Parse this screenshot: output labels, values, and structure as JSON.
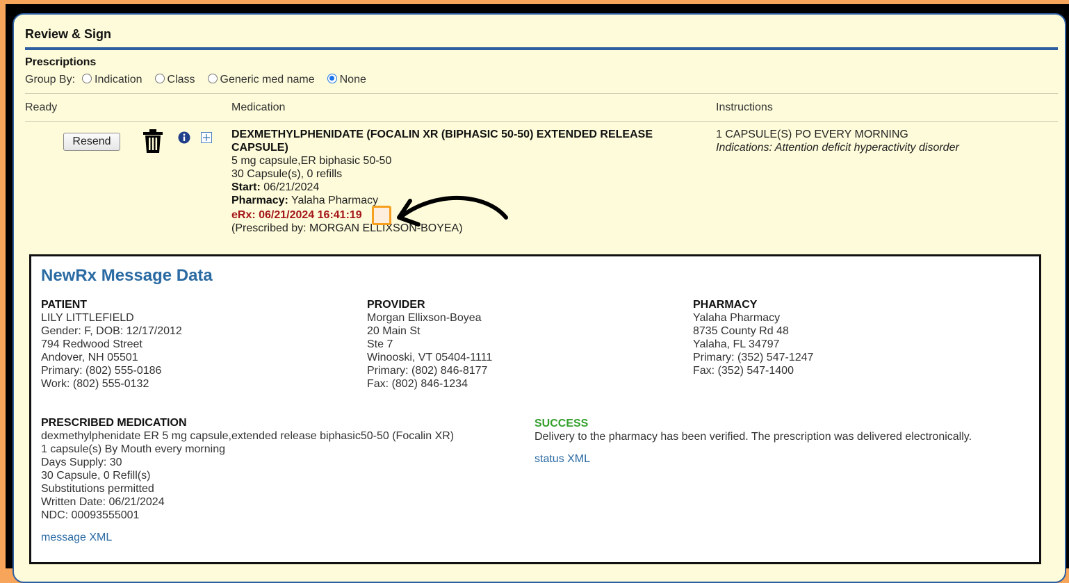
{
  "panel": {
    "title": "Review & Sign",
    "section_heading": "Prescriptions",
    "group_by": {
      "label": "Group By:",
      "options": [
        "Indication",
        "Class",
        "Generic med name",
        "None"
      ],
      "selected": "None"
    }
  },
  "table": {
    "headers": {
      "ready": "Ready",
      "medication": "Medication",
      "instructions": "Instructions"
    },
    "row": {
      "resend_label": "Resend",
      "icons": [
        "trash-icon",
        "info-icon",
        "expand-icon"
      ],
      "medication": {
        "name": "DEXMETHYLPHENIDATE (FOCALIN XR (BIPHASIC 50-50) EXTENDED RELEASE CAPSULE)",
        "form": "5 mg capsule,ER biphasic 50-50",
        "quantity": "30 Capsule(s), 0 refills",
        "start_label": "Start:",
        "start_value": "06/21/2024",
        "pharmacy_label": "Pharmacy:",
        "pharmacy_value": "Yalaha Pharmacy",
        "erx": "eRx: 06/21/2024 16:41:19",
        "prescribed_by": "(Prescribed by: MORGAN ELLIXSON-BOYEA)"
      },
      "instructions": {
        "sig": "1 CAPSULE(S) PO EVERY MORNING",
        "indications": "Indications: Attention deficit hyperactivity disorder"
      }
    }
  },
  "message": {
    "title": "NewRx Message Data",
    "patient": {
      "heading": "PATIENT",
      "lines": [
        "LILY LITTLEFIELD",
        "Gender: F, DOB: 12/17/2012",
        "794 Redwood Street",
        "Andover, NH 05501",
        "Primary: (802) 555-0186",
        "Work: (802) 555-0132"
      ]
    },
    "provider": {
      "heading": "PROVIDER",
      "lines": [
        "Morgan Ellixson-Boyea",
        "20 Main St",
        "Ste 7",
        "Winooski, VT 05404-1111",
        "Primary: (802) 846-8177",
        "Fax: (802) 846-1234"
      ]
    },
    "pharmacy": {
      "heading": "PHARMACY",
      "lines": [
        "Yalaha Pharmacy",
        "8735 County Rd 48",
        "Yalaha, FL 34797",
        "Primary: (352) 547-1247",
        "Fax: (352) 547-1400"
      ]
    },
    "prescribed_medication": {
      "heading": "PRESCRIBED MEDICATION",
      "lines": [
        "dexmethylphenidate ER 5 mg capsule,extended release biphasic50-50 (Focalin XR)",
        "1 capsule(s) By Mouth every morning",
        "Days Supply: 30",
        "30 Capsule, 0 Refill(s)",
        "Substitutions permitted",
        "Written Date: 06/21/2024",
        "NDC: 00093555001"
      ],
      "link": "message XML"
    },
    "status": {
      "heading": "SUCCESS",
      "text": "Delivery to the pharmacy has been verified. The prescription was delivered electronically.",
      "link": "status XML"
    }
  },
  "colors": {
    "accent": "#2d5ea1",
    "background": "#fdfbd9",
    "erx": "#a4161a",
    "success": "#33a02c",
    "highlight": "#f7a01f"
  }
}
